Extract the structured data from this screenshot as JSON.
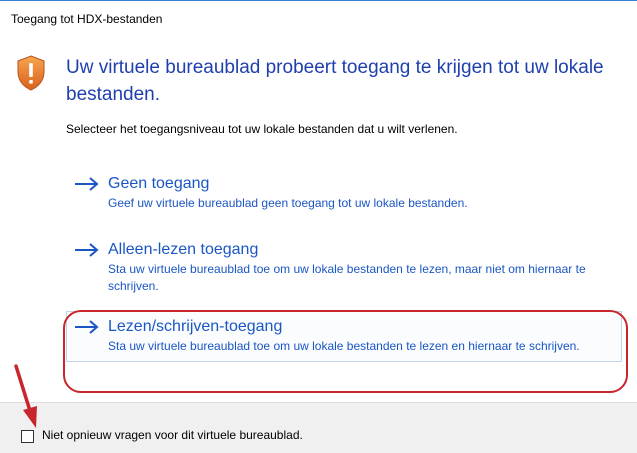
{
  "window": {
    "title": "Toegang tot HDX-bestanden"
  },
  "dialog": {
    "heading": "Uw virtuele bureaublad probeert toegang te krijgen tot uw lokale bestanden.",
    "instruction": "Selecteer het toegangsniveau tot uw lokale bestanden dat u wilt verlenen.",
    "options": [
      {
        "title": "Geen toegang",
        "description": "Geef uw virtuele bureaublad geen toegang tot uw lokale bestanden."
      },
      {
        "title": "Alleen-lezen toegang",
        "description": "Sta uw virtuele bureaublad toe om uw lokale bestanden te lezen, maar niet om hiernaar te schrijven."
      },
      {
        "title": "Lezen/schrijven-toegang",
        "description": "Sta uw virtuele bureaublad toe om uw lokale bestanden te lezen en hiernaar te schrijven."
      }
    ]
  },
  "footer": {
    "checkbox_label": "Niet opnieuw vragen voor dit virtuele bureaublad.",
    "checked": false
  },
  "icons": {
    "warning": "shield-warning-icon",
    "option_arrow": "arrow-right-icon",
    "annotation": "red-arrow-annotation"
  },
  "colors": {
    "link": "#1a56c4",
    "heading": "#1f3fae",
    "highlight": "#c8262c",
    "shield": "#e8822e"
  }
}
